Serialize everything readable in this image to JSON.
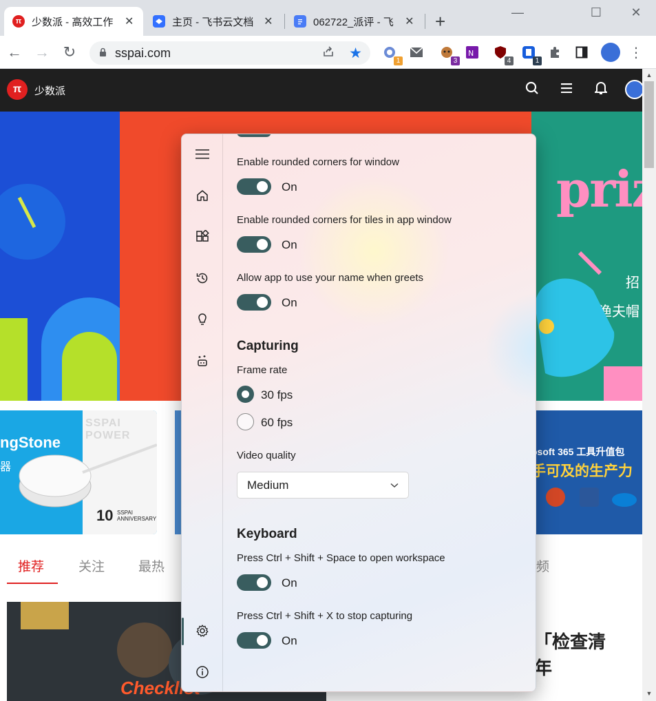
{
  "browser": {
    "tabs": [
      {
        "title": "少数派 - 高效工作",
        "favicon": "π",
        "favicon_color": "#e02020",
        "active": true
      },
      {
        "title": "主页 - 飞书云文档",
        "favicon": "",
        "favicon_color": "#3370ff",
        "active": false
      },
      {
        "title": "062722_派评 - 飞",
        "favicon": "",
        "favicon_color": "#4a7cf6",
        "active": false
      }
    ],
    "address": "sspai.com",
    "extension_badges": [
      "1",
      "3",
      "4",
      "1"
    ]
  },
  "site": {
    "name": "少数派",
    "logo_glyph": "π",
    "banner_right": {
      "headline": "priz",
      "line1": "招",
      "line2": "渔夫帽"
    },
    "promo_left": {
      "title": "ngStone",
      "sub": "器",
      "anniversary": "10",
      "brand": "SSPAI POWER",
      "anniv_label": "SSPAI ANNIVERSARY"
    },
    "promo_right": {
      "line1": "osoft 365  工具升值包",
      "line2": "手可及的生产力"
    },
    "tabs": [
      "推荐",
      "关注",
      "最热",
      "频"
    ],
    "article_title": "「检查清",
    "article_sub": "年",
    "article_image_text": "Checklist"
  },
  "app": {
    "settings": [
      {
        "label": "Enable rounded corners for window",
        "state": "On"
      },
      {
        "label": "Enable rounded corners for tiles in app window",
        "state": "On"
      },
      {
        "label": "Allow app to use your name when greets",
        "state": "On"
      }
    ],
    "capturing": {
      "title": "Capturing",
      "frame_rate_label": "Frame rate",
      "options": [
        "30 fps",
        "60 fps"
      ],
      "selected": "30 fps",
      "video_quality_label": "Video quality",
      "video_quality_value": "Medium"
    },
    "keyboard": {
      "title": "Keyboard",
      "shortcuts": [
        {
          "label": "Press Ctrl + Shift + Space to open workspace",
          "state": "On"
        },
        {
          "label": "Press Ctrl + Shift + X to stop capturing",
          "state": "On"
        }
      ]
    }
  }
}
